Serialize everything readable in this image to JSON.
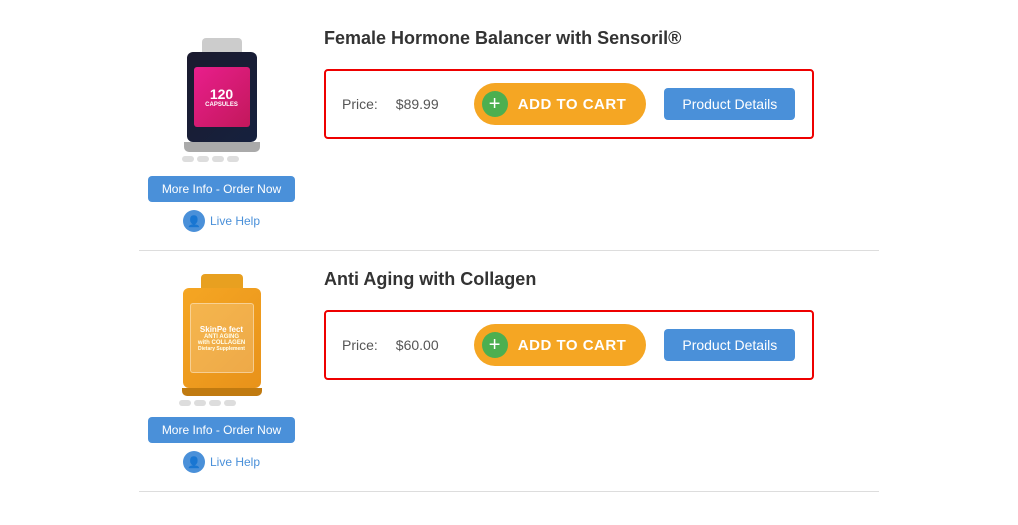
{
  "products": [
    {
      "id": "product-1",
      "name": "Female Hormone Balancer with Sensoril®",
      "price": "$89.99",
      "more_info_label": "More Info - Order Now",
      "live_help_label": "Live Help",
      "add_to_cart_label": "ADD TO CART",
      "product_details_label": "Product Details",
      "price_prefix": "Price:"
    },
    {
      "id": "product-2",
      "name": "Anti Aging with Collagen",
      "price": "$60.00",
      "more_info_label": "More Info - Order Now",
      "live_help_label": "Live Help",
      "add_to_cart_label": "ADD TO CART",
      "product_details_label": "Product Details",
      "price_prefix": "Price:"
    }
  ]
}
